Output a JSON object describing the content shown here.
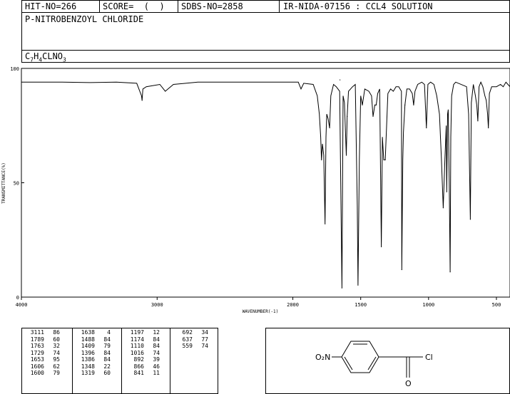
{
  "header": {
    "hit_no": "HIT-NO=266",
    "score": "SCORE=  (  )",
    "sdbs_no": "SDBS-NO=2858",
    "ir_info": "IR-NIDA-07156 : CCL4 SOLUTION",
    "compound_name": "P-NITROBENZOYL CHLORIDE",
    "formula": {
      "c": "C",
      "c_n": "7",
      "h": "H",
      "h_n": "4",
      "rest": "CLNO",
      "o_n": "3"
    }
  },
  "chart_data": {
    "type": "line",
    "title": "",
    "xlabel": "WAVENUMBER(-1)",
    "ylabel": "TRANSMITTANCE(%)",
    "x_reversed": true,
    "xlim": [
      4000,
      400
    ],
    "ylim": [
      0,
      100
    ],
    "xticks": [
      4000,
      3000,
      2000,
      1500,
      1000,
      500
    ],
    "yticks": [
      0,
      50,
      100
    ],
    "series": [
      {
        "name": "",
        "points": [
          [
            4000,
            94
          ],
          [
            3700,
            94
          ],
          [
            3500,
            93.8
          ],
          [
            3300,
            94
          ],
          [
            3150,
            93.5
          ],
          [
            3115,
            88
          ],
          [
            3111,
            86
          ],
          [
            3105,
            91
          ],
          [
            3080,
            92
          ],
          [
            2980,
            93
          ],
          [
            2940,
            90
          ],
          [
            2920,
            91
          ],
          [
            2880,
            93
          ],
          [
            2700,
            94
          ],
          [
            2400,
            94
          ],
          [
            2100,
            94
          ],
          [
            1960,
            94
          ],
          [
            1940,
            91
          ],
          [
            1920,
            93.5
          ],
          [
            1850,
            93
          ],
          [
            1820,
            88
          ],
          [
            1805,
            80
          ],
          [
            1795,
            70
          ],
          [
            1789,
            60
          ],
          [
            1782,
            67
          ],
          [
            1772,
            62
          ],
          [
            1763,
            32
          ],
          [
            1756,
            70
          ],
          [
            1750,
            80
          ],
          [
            1740,
            78
          ],
          [
            1729,
            74
          ],
          [
            1720,
            88
          ],
          [
            1700,
            93
          ],
          [
            1680,
            92
          ],
          [
            1655,
            90
          ],
          [
            1638,
            4
          ],
          [
            1630,
            88
          ],
          [
            1620,
            85
          ],
          [
            1606,
            62
          ],
          [
            1600,
            79
          ],
          [
            1590,
            90
          ],
          [
            1560,
            92
          ],
          [
            1540,
            93
          ],
          [
            1525,
            40
          ],
          [
            1520,
            5
          ],
          [
            1510,
            60
          ],
          [
            1500,
            88
          ],
          [
            1488,
            84
          ],
          [
            1470,
            91
          ],
          [
            1440,
            90
          ],
          [
            1420,
            88
          ],
          [
            1409,
            79
          ],
          [
            1396,
            84
          ],
          [
            1386,
            84
          ],
          [
            1375,
            89
          ],
          [
            1360,
            91
          ],
          [
            1348,
            22
          ],
          [
            1340,
            70
          ],
          [
            1330,
            60
          ],
          [
            1319,
            60
          ],
          [
            1300,
            89
          ],
          [
            1280,
            91
          ],
          [
            1260,
            90
          ],
          [
            1240,
            92
          ],
          [
            1220,
            92
          ],
          [
            1200,
            90
          ],
          [
            1197,
            12
          ],
          [
            1190,
            60
          ],
          [
            1185,
            72
          ],
          [
            1174,
            84
          ],
          [
            1160,
            91
          ],
          [
            1140,
            91
          ],
          [
            1120,
            89
          ],
          [
            1110,
            84
          ],
          [
            1100,
            90
          ],
          [
            1080,
            93
          ],
          [
            1050,
            94
          ],
          [
            1030,
            93
          ],
          [
            1016,
            74
          ],
          [
            1005,
            93
          ],
          [
            985,
            94
          ],
          [
            960,
            93
          ],
          [
            940,
            88
          ],
          [
            920,
            80
          ],
          [
            905,
            60
          ],
          [
            892,
            39
          ],
          [
            880,
            60
          ],
          [
            870,
            75
          ],
          [
            866,
            46
          ],
          [
            860,
            80
          ],
          [
            855,
            82
          ],
          [
            848,
            50
          ],
          [
            841,
            11
          ],
          [
            836,
            70
          ],
          [
            830,
            88
          ],
          [
            815,
            93
          ],
          [
            800,
            94
          ],
          [
            720,
            92
          ],
          [
            705,
            80
          ],
          [
            692,
            34
          ],
          [
            685,
            85
          ],
          [
            670,
            93
          ],
          [
            655,
            88
          ],
          [
            645,
            84
          ],
          [
            637,
            77
          ],
          [
            628,
            92
          ],
          [
            615,
            94
          ],
          [
            600,
            92
          ],
          [
            585,
            88
          ],
          [
            575,
            86
          ],
          [
            565,
            80
          ],
          [
            559,
            74
          ],
          [
            552,
            89
          ],
          [
            535,
            92
          ],
          [
            500,
            92
          ],
          [
            470,
            93
          ],
          [
            450,
            92
          ],
          [
            430,
            94
          ],
          [
            415,
            93
          ],
          [
            400,
            92
          ]
        ]
      }
    ],
    "peaks": [
      [
        3111,
        86
      ],
      [
        1789,
        60
      ],
      [
        1763,
        32
      ],
      [
        1729,
        74
      ],
      [
        1653,
        95
      ],
      [
        1606,
        62
      ],
      [
        1600,
        79
      ],
      [
        1638,
        4
      ],
      [
        1488,
        84
      ],
      [
        1409,
        79
      ],
      [
        1396,
        84
      ],
      [
        1386,
        84
      ],
      [
        1348,
        22
      ],
      [
        1319,
        60
      ],
      [
        1197,
        12
      ],
      [
        1174,
        84
      ],
      [
        1110,
        84
      ],
      [
        1016,
        74
      ],
      [
        892,
        39
      ],
      [
        866,
        46
      ],
      [
        841,
        11
      ],
      [
        692,
        34
      ],
      [
        637,
        77
      ],
      [
        559,
        74
      ]
    ]
  },
  "peak_table": [
    [
      [
        "3111",
        "86"
      ],
      [
        "1789",
        "60"
      ],
      [
        "1763",
        "32"
      ],
      [
        "1729",
        "74"
      ],
      [
        "1653",
        "95"
      ],
      [
        "1606",
        "62"
      ],
      [
        "1600",
        "79"
      ]
    ],
    [
      [
        "1638",
        "4"
      ],
      [
        "1488",
        "84"
      ],
      [
        "1409",
        "79"
      ],
      [
        "1396",
        "84"
      ],
      [
        "1386",
        "84"
      ],
      [
        "1348",
        "22"
      ],
      [
        "1319",
        "60"
      ]
    ],
    [
      [
        "1197",
        "12"
      ],
      [
        "1174",
        "84"
      ],
      [
        "1110",
        "84"
      ],
      [
        "1016",
        "74"
      ],
      [
        "892",
        "39"
      ],
      [
        "866",
        "46"
      ],
      [
        "841",
        "11"
      ]
    ],
    [
      [
        "692",
        "34"
      ],
      [
        "637",
        "77"
      ],
      [
        "559",
        "74"
      ],
      [
        "",
        ""
      ],
      [
        "",
        ""
      ],
      [
        "",
        ""
      ],
      [
        "",
        ""
      ]
    ]
  ],
  "structure": {
    "nitro_label": "O₂N",
    "chlorine_label": "Cl",
    "oxygen_label": "O"
  }
}
